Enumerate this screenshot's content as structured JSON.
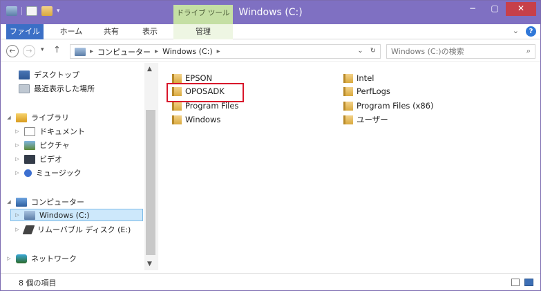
{
  "window": {
    "title": "Windows (C:)",
    "context_tab": "ドライブ ツール",
    "controls": {
      "minimize": "−",
      "maximize": "▢",
      "close": "✕"
    }
  },
  "ribbon": {
    "tabs": [
      {
        "label": "ファイル"
      },
      {
        "label": "ホーム"
      },
      {
        "label": "共有"
      },
      {
        "label": "表示"
      },
      {
        "label": "管理"
      }
    ],
    "expand_glyph": "⌄",
    "help_glyph": "?"
  },
  "navigation": {
    "back_glyph": "←",
    "forward_glyph": "→",
    "recent_glyph": "▾",
    "up_glyph": "↑",
    "breadcrumb": [
      "コンピューター",
      "Windows (C:)"
    ],
    "separator": "▸",
    "dropdown_glyph": "⌄",
    "refresh_glyph": "↻",
    "search_placeholder": "Windows (C:)の検索",
    "search_glyph": "⌕"
  },
  "tree": {
    "items": [
      {
        "label": "デスクトップ"
      },
      {
        "label": "最近表示した場所"
      },
      {
        "label": "ライブラリ"
      },
      {
        "label": "ドキュメント"
      },
      {
        "label": "ピクチャ"
      },
      {
        "label": "ビデオ"
      },
      {
        "label": "ミュージック"
      },
      {
        "label": "コンピューター"
      },
      {
        "label": "Windows (C:)"
      },
      {
        "label": "リムーバブル ディスク (E:)"
      },
      {
        "label": "ネットワーク"
      }
    ]
  },
  "files": [
    {
      "name": "EPSON"
    },
    {
      "name": "Intel"
    },
    {
      "name": "OPOSADK"
    },
    {
      "name": "PerfLogs"
    },
    {
      "name": "Program Files"
    },
    {
      "name": "Program Files (x86)"
    },
    {
      "name": "Windows"
    },
    {
      "name": "ユーザー"
    }
  ],
  "status": {
    "item_count": "8 個の項目"
  },
  "colors": {
    "title_bar": "#7f70c2",
    "context_tab": "#c5dfa4",
    "file_tab": "#3b6fc6",
    "highlight_box": "#d8152a",
    "selection": "#cde8fb"
  }
}
